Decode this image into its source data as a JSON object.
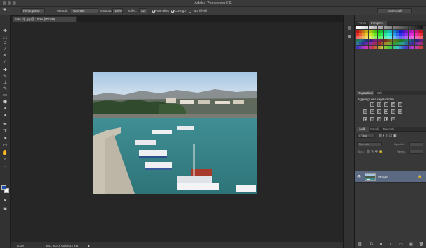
{
  "app": {
    "title": "Adobe Photoshop CC"
  },
  "options_bar": {
    "mode_value": "Primo piano",
    "method_label": "Metodo:",
    "method_value": "Normale",
    "opacity_label": "Opacità:",
    "opacity_value": "100%",
    "tolerance_label": "Toller.:",
    "tolerance_value": "32",
    "antialias_label": "Anti-alias",
    "contiguous_label": "Contigui",
    "all_layers_label": "Tutti i livelli",
    "workspace_label": "Essenziali"
  },
  "document": {
    "tab_label": "Foto (2).jpg @ 100% (RGB/8)"
  },
  "status": {
    "zoom": "100%",
    "doc_info": "Doc: 603,3 KB/603,3 KB"
  },
  "panels": {
    "color_tabs": [
      "Colore",
      "Campioni"
    ],
    "adjust_tabs": [
      "Regolazioni",
      "Stili"
    ],
    "adjust_title": "Aggiungi una regolazione",
    "layers_tabs": [
      "Livelli",
      "Canali",
      "Tracciati"
    ],
    "layer_kind": "Tipo",
    "layer_blend": "Normale",
    "layer_opacity_label": "Opacità:",
    "layer_lock_label": "Bloc.:",
    "layer_fill_label": "Riemp.:",
    "layer_name": "Sfondo"
  },
  "icons": {
    "tools": [
      "move-icon",
      "marquee-icon",
      "lasso-icon",
      "quick-select-icon",
      "crop-icon",
      "eyedropper-icon",
      "healing-brush-icon",
      "brush-icon",
      "clone-stamp-icon",
      "history-brush-icon",
      "eraser-icon",
      "paint-bucket-icon",
      "blur-icon",
      "dodge-icon",
      "pen-icon",
      "type-icon",
      "path-select-icon",
      "rectangle-icon",
      "hand-icon",
      "zoom-icon"
    ]
  },
  "colors": {
    "foreground": "#1f4fa8",
    "background": "#ffffff",
    "layer_selected": "#5b6a82"
  }
}
